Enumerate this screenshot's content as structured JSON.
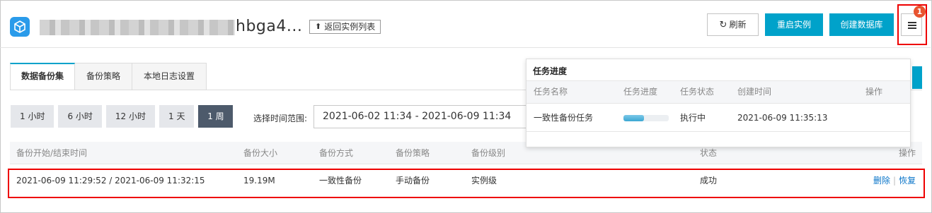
{
  "header": {
    "instance_name": "hbga4...",
    "back_label": "返回实例列表",
    "refresh_label": "刷新",
    "restart_label": "重启实例",
    "create_db_label": "创建数据库",
    "task_badge": "1"
  },
  "tabs": [
    {
      "label": "数据备份集",
      "active": true
    },
    {
      "label": "备份策略",
      "active": false
    },
    {
      "label": "本地日志设置",
      "active": false
    }
  ],
  "ranges": [
    {
      "label": "1 小时",
      "active": false
    },
    {
      "label": "6 小时",
      "active": false
    },
    {
      "label": "12 小时",
      "active": false
    },
    {
      "label": "1 天",
      "active": false
    },
    {
      "label": "1 周",
      "active": true
    }
  ],
  "time_range": {
    "label": "选择时间范围:",
    "value": "2021-06-02 11:34  -  2021-06-09 11:34"
  },
  "table": {
    "columns": [
      "备份开始/结束时间",
      "备份大小",
      "备份方式",
      "备份策略",
      "备份级别",
      "状态",
      "操作"
    ],
    "rows": [
      {
        "time": "2021-06-09 11:29:52 / 2021-06-09 11:32:15",
        "size": "19.19M",
        "method": "一致性备份",
        "policy": "手动备份",
        "level": "实例级",
        "status": "成功",
        "action_delete": "删除",
        "action_sep": "|",
        "action_restore": "恢复"
      }
    ]
  },
  "task_popover": {
    "title": "任务进度",
    "columns": [
      "任务名称",
      "任务进度",
      "任务状态",
      "创建时间",
      "操作"
    ],
    "rows": [
      {
        "name": "一致性备份任务",
        "progress": 0.45,
        "status": "执行中",
        "created": "2021-06-09 11:35:13",
        "action": ""
      }
    ]
  },
  "colors": {
    "accent": "#00a2ca",
    "link": "#0a75c9",
    "highlight": "#e00000",
    "badge": "#e8542f"
  },
  "icons": {
    "logo": "database-logo-icon",
    "back": "arrow-up-icon",
    "refresh": "refresh-icon",
    "tasks": "list-icon"
  }
}
